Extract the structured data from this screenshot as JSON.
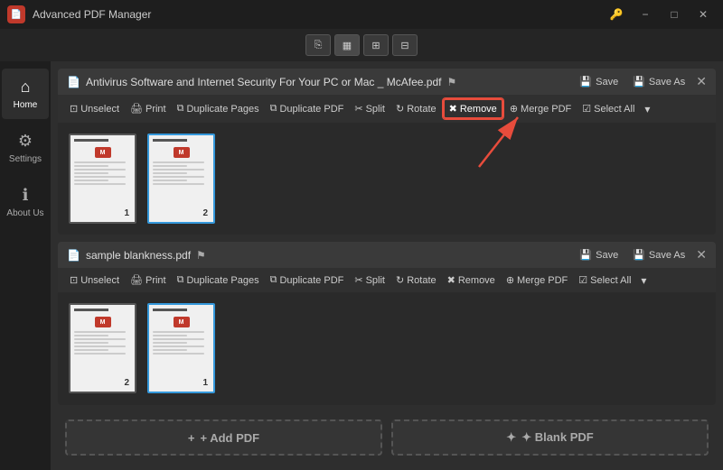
{
  "app": {
    "title": "Advanced PDF Manager",
    "icon_label": "PDF"
  },
  "titlebar": {
    "pin_btn": "📌",
    "minimize_btn": "−",
    "maximize_btn": "□",
    "close_btn": "✕"
  },
  "toolbar_strip": {
    "buttons": [
      "⎘",
      "▦",
      "⊞",
      "⊟"
    ]
  },
  "sidebar": {
    "items": [
      {
        "id": "home",
        "icon": "⌂",
        "label": "Home",
        "active": true
      },
      {
        "id": "settings",
        "icon": "⚙",
        "label": "Settings",
        "active": false
      },
      {
        "id": "about",
        "icon": "ℹ",
        "label": "About Us",
        "active": false
      }
    ]
  },
  "pdf1": {
    "title": "Antivirus Software and Internet Security For Your PC or Mac _ McAfee.pdf",
    "title_icon": "📄",
    "actions": {
      "save": "Save",
      "save_as": "Save As",
      "close": "✕"
    },
    "toolbar": {
      "unselect": "Unselect",
      "print": "Print",
      "duplicate_pages": "Duplicate Pages",
      "duplicate_pdf": "Duplicate PDF",
      "split": "Split",
      "rotate": "Rotate",
      "remove": "Remove",
      "merge_pdf": "Merge PDF",
      "select_all": "Select All"
    },
    "pages": [
      {
        "number": "1",
        "selected": false
      },
      {
        "number": "2",
        "selected": true
      }
    ]
  },
  "pdf2": {
    "title": "sample blankness.pdf",
    "title_icon": "📄",
    "actions": {
      "save": "Save",
      "save_as": "Save As",
      "close": "✕"
    },
    "toolbar": {
      "unselect": "Unselect",
      "print": "Print",
      "duplicate_pages": "Duplicate Pages",
      "duplicate_pdf": "Duplicate PDF",
      "split": "Split",
      "rotate": "Rotate",
      "remove": "Remove",
      "merge_pdf": "Merge PDF",
      "select_all": "Select All"
    },
    "pages": [
      {
        "number": "2",
        "selected": false
      },
      {
        "number": "1",
        "selected": true
      }
    ]
  },
  "bottom_buttons": {
    "add_pdf": "+ Add PDF",
    "blank_pdf": "✦ Blank PDF"
  },
  "arrow": {
    "tooltip": "Remove button highlighted"
  }
}
